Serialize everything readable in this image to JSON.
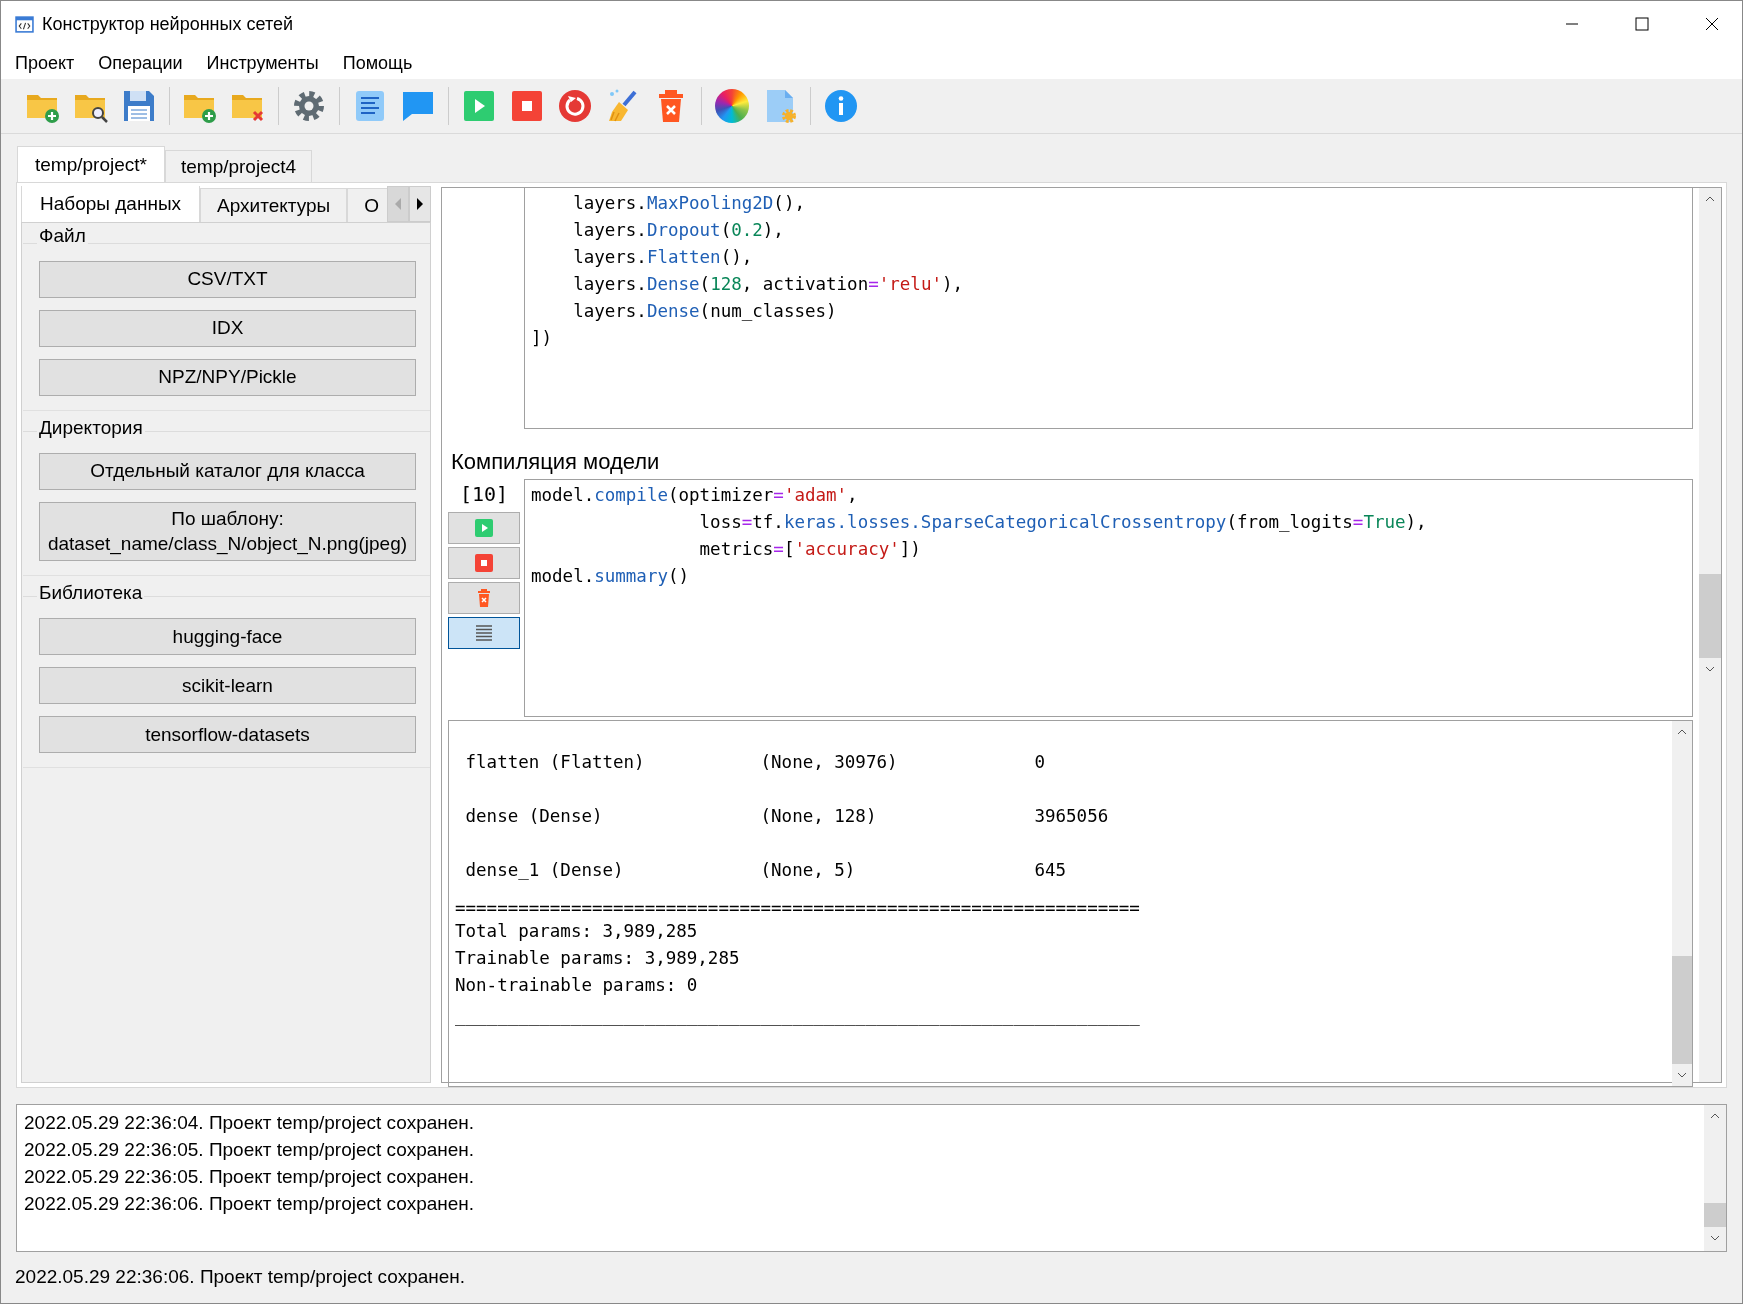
{
  "window": {
    "title": "Конструктор нейронных сетей"
  },
  "menu": [
    "Проект",
    "Операции",
    "Инструменты",
    "Помощь"
  ],
  "toolbar": [
    [
      {
        "kind": "new-project"
      },
      {
        "kind": "open-project"
      },
      {
        "kind": "save"
      }
    ],
    [
      {
        "kind": "add-folder"
      },
      {
        "kind": "remove-folder"
      }
    ],
    [
      {
        "kind": "settings"
      }
    ],
    [
      {
        "kind": "notes"
      },
      {
        "kind": "comment"
      }
    ],
    [
      {
        "kind": "run"
      },
      {
        "kind": "stop"
      },
      {
        "kind": "restart"
      },
      {
        "kind": "clear"
      },
      {
        "kind": "delete"
      }
    ],
    [
      {
        "kind": "palette"
      },
      {
        "kind": "file-settings"
      }
    ],
    [
      {
        "kind": "info"
      }
    ]
  ],
  "project_tabs": [
    {
      "label": "temp/project*",
      "selected": true
    },
    {
      "label": "temp/project4",
      "selected": false
    }
  ],
  "sidebar": {
    "tabs": [
      {
        "label": "Наборы данных",
        "selected": true
      },
      {
        "label": "Архитектуры",
        "selected": false
      },
      {
        "label": "О",
        "selected": false
      }
    ],
    "groups": [
      {
        "title": "Файл",
        "buttons": [
          "CSV/TXT",
          "IDX",
          "NPZ/NPY/Pickle"
        ]
      },
      {
        "title": "Директория",
        "buttons": [
          "Отдельный каталог для класса",
          "По шаблону:\ndataset_name/class_N/object_N.png(jpeg)"
        ]
      },
      {
        "title": "Библиотека",
        "buttons": [
          "hugging-face",
          "scikit-learn",
          "tensorflow-datasets"
        ]
      }
    ]
  },
  "cells": [
    {
      "code": [
        [
          {
            "t": "    layers.",
            "kind": "text"
          },
          {
            "t": "MaxPooling2D",
            "kind": "call"
          },
          {
            "t": "(),",
            "kind": "text"
          }
        ],
        [
          {
            "t": "    layers.",
            "kind": "text"
          },
          {
            "t": "Dropout",
            "kind": "call"
          },
          {
            "t": "(",
            "kind": "text"
          },
          {
            "t": "0.2",
            "kind": "number"
          },
          {
            "t": "),",
            "kind": "text"
          }
        ],
        [
          {
            "t": "    layers.",
            "kind": "text"
          },
          {
            "t": "Flatten",
            "kind": "call"
          },
          {
            "t": "(),",
            "kind": "text"
          }
        ],
        [
          {
            "t": "    layers.",
            "kind": "text"
          },
          {
            "t": "Dense",
            "kind": "call"
          },
          {
            "t": "(",
            "kind": "text"
          },
          {
            "t": "128",
            "kind": "number"
          },
          {
            "t": ", activation",
            "kind": "text"
          },
          {
            "t": "=",
            "kind": "operator"
          },
          {
            "t": "'relu'",
            "kind": "string"
          },
          {
            "t": "),",
            "kind": "text"
          }
        ],
        [
          {
            "t": "    layers.",
            "kind": "text"
          },
          {
            "t": "Dense",
            "kind": "call"
          },
          {
            "t": "(num_classes)",
            "kind": "text"
          }
        ],
        [
          {
            "t": "])",
            "kind": "text"
          }
        ]
      ]
    },
    {
      "heading": "Компиляция модели",
      "number": "[10]",
      "controls": [
        {
          "kind": "run",
          "on": false
        },
        {
          "kind": "stop",
          "on": false
        },
        {
          "kind": "delete",
          "on": false
        },
        {
          "kind": "output",
          "on": true
        }
      ],
      "code": [
        [
          {
            "t": "model.",
            "kind": "text"
          },
          {
            "t": "compile",
            "kind": "call"
          },
          {
            "t": "(optimizer",
            "kind": "text"
          },
          {
            "t": "=",
            "kind": "operator"
          },
          {
            "t": "'adam'",
            "kind": "string"
          },
          {
            "t": ",",
            "kind": "text"
          }
        ],
        [
          {
            "t": "                loss",
            "kind": "text"
          },
          {
            "t": "=",
            "kind": "operator"
          },
          {
            "t": "tf.",
            "kind": "text"
          },
          {
            "t": "keras.losses.SparseCategoricalCrossentropy",
            "kind": "call"
          },
          {
            "t": "(from_logits",
            "kind": "text"
          },
          {
            "t": "=",
            "kind": "operator"
          },
          {
            "t": "True",
            "kind": "constant"
          },
          {
            "t": "),",
            "kind": "text"
          }
        ],
        [
          {
            "t": "                metrics",
            "kind": "text"
          },
          {
            "t": "=",
            "kind": "operator"
          },
          {
            "t": "[",
            "kind": "text"
          },
          {
            "t": "'accuracy'",
            "kind": "string"
          },
          {
            "t": "])",
            "kind": "text"
          }
        ],
        [
          {
            "t": "model.",
            "kind": "text"
          },
          {
            "t": "summary",
            "kind": "call"
          },
          {
            "t": "()",
            "kind": "text"
          }
        ]
      ],
      "output": {
        "layers": [
          " flatten (Flatten)           (None, 30976)             0",
          " dense (Dense)               (None, 128)               3965056",
          " dense_1 (Dense)             (None, 5)                 645"
        ],
        "rule": "=================================================================",
        "totals": [
          "Total params: 3,989,285",
          "Trainable params: 3,989,285",
          "Non-trainable params: 0"
        ],
        "bottom_rule": "_________________________________________________________________"
      }
    }
  ],
  "log": [
    "2022.05.29 22:36:04. Проект temp/project сохранен.",
    "2022.05.29 22:36:05. Проект temp/project сохранен.",
    "2022.05.29 22:36:05. Проект temp/project сохранен.",
    "2022.05.29 22:36:06. Проект temp/project сохранен."
  ],
  "status_bar": "2022.05.29 22:36:06. Проект temp/project сохранен."
}
